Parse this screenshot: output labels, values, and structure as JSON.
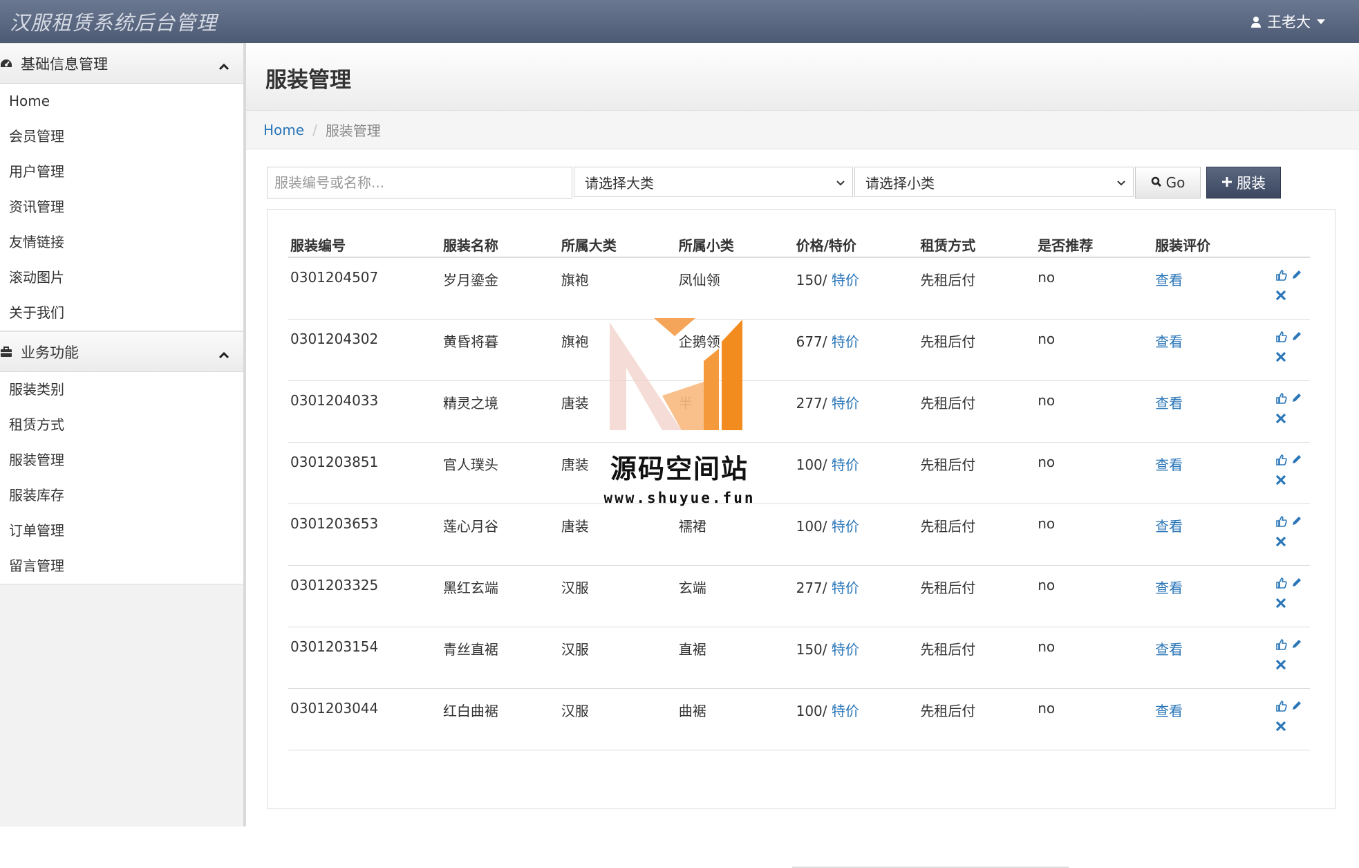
{
  "app": {
    "title": "汉服租赁系统后台管理"
  },
  "user": {
    "name": "王老大"
  },
  "sidebar": {
    "sections": [
      {
        "title": "基础信息管理",
        "items": [
          "Home",
          "会员管理",
          "用户管理",
          "资讯管理",
          "友情链接",
          "滚动图片",
          "关于我们"
        ]
      },
      {
        "title": "业务功能",
        "items": [
          "服装类别",
          "租赁方式",
          "服装管理",
          "服装库存",
          "订单管理",
          "留言管理"
        ]
      }
    ]
  },
  "page": {
    "title": "服装管理"
  },
  "breadcrumb": {
    "home": "Home",
    "current": "服装管理"
  },
  "search": {
    "placeholder": "服装编号或名称...",
    "category_select": "请选择大类",
    "subcategory_select": "请选择小类",
    "go_label": "Go",
    "add_label": "服装"
  },
  "table": {
    "headers": [
      "服装编号",
      "服装名称",
      "所属大类",
      "所属小类",
      "价格/特价",
      "租赁方式",
      "是否推荐",
      "服装评价"
    ],
    "rows": [
      {
        "id": "0301204507",
        "name": "岁月鎏金",
        "category": "旗袍",
        "subcategory": "凤仙领",
        "price": "150/",
        "special": "特价",
        "rent": "先租后付",
        "recommend": "no",
        "review": "查看"
      },
      {
        "id": "0301204302",
        "name": "黄昏将暮",
        "category": "旗袍",
        "subcategory": "企鹅领",
        "price": "677/",
        "special": "特价",
        "rent": "先租后付",
        "recommend": "no",
        "review": "查看"
      },
      {
        "id": "0301204033",
        "name": "精灵之境",
        "category": "唐装",
        "subcategory": "半",
        "price": "277/",
        "special": "特价",
        "rent": "先租后付",
        "recommend": "no",
        "review": "查看"
      },
      {
        "id": "0301203851",
        "name": "官人璞头",
        "category": "唐装",
        "subcategory": "",
        "price": "100/",
        "special": "特价",
        "rent": "先租后付",
        "recommend": "no",
        "review": "查看"
      },
      {
        "id": "0301203653",
        "name": "莲心月谷",
        "category": "唐装",
        "subcategory": "襦裙",
        "price": "100/",
        "special": "特价",
        "rent": "先租后付",
        "recommend": "no",
        "review": "查看"
      },
      {
        "id": "0301203325",
        "name": "黑红玄端",
        "category": "汉服",
        "subcategory": "玄端",
        "price": "277/",
        "special": "特价",
        "rent": "先租后付",
        "recommend": "no",
        "review": "查看"
      },
      {
        "id": "0301203154",
        "name": "青丝直裾",
        "category": "汉服",
        "subcategory": "直裾",
        "price": "150/",
        "special": "特价",
        "rent": "先租后付",
        "recommend": "no",
        "review": "查看"
      },
      {
        "id": "0301203044",
        "name": "红白曲裾",
        "category": "汉服",
        "subcategory": "曲裾",
        "price": "100/",
        "special": "特价",
        "rent": "先租后付",
        "recommend": "no",
        "review": "查看"
      }
    ]
  },
  "watermark": {
    "title": "源码空间站",
    "url": "www.shuyue.fun"
  },
  "colors": {
    "link": "#2a76b8",
    "topbar": "#5b6781",
    "accent_orange": "#f28c1e"
  }
}
